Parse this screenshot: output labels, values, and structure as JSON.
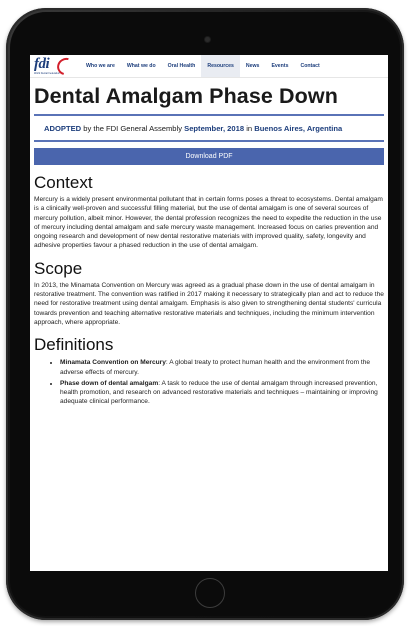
{
  "nav": {
    "logo_text": "fdi",
    "logo_subtitle": "World Dental Federation",
    "items": [
      {
        "label": "Who we are"
      },
      {
        "label": "What we do"
      },
      {
        "label": "Oral Health"
      },
      {
        "label": "Resources"
      },
      {
        "label": "News"
      },
      {
        "label": "Events"
      },
      {
        "label": "Contact"
      }
    ],
    "active_item": "Resources"
  },
  "page": {
    "title": "Dental Amalgam Phase Down",
    "adopted": {
      "strong1": "ADOPTED",
      "text1": " by the FDI General Assembly ",
      "strong2": "September, 2018",
      "text2": " in ",
      "strong3": "Buenos Aires, Argentina"
    },
    "download_label": "Download PDF",
    "sections": [
      {
        "heading": "Context",
        "body": "Mercury is a widely present environmental pollutant that in certain forms poses a threat to ecosystems. Dental amalgam is a clinically well-proven and successful filling material, but the use of dental amalgam is one of several sources of mercury pollution, albeit minor. However, the dental profession recognizes the need to expedite the reduction in the use of mercury including dental amalgam and safe mercury waste management. Increased focus on caries prevention and ongoing research and development of new dental restorative materials with improved quality, safety, longevity and adhesive properties favour a phased reduction in the use of dental amalgam."
      },
      {
        "heading": "Scope",
        "body": "In 2013, the Minamata Convention on Mercury was agreed as a gradual phase down in the use of dental amalgam in restorative treatment. The convention was ratified in 2017 making it necessary to strategically plan and act to reduce the need for restorative treatment using dental amalgam. Emphasis is also given to strengthening dental students' curricula towards prevention and teaching alternative restorative materials and techniques, including the minimum intervention approach, where appropriate."
      },
      {
        "heading": "Definitions",
        "items": [
          {
            "term": "Minamata Convention on Mercury",
            "text": ": A global treaty to protect human health and the environment from the adverse effects of mercury."
          },
          {
            "term": "Phase down of dental amalgam",
            "text": ": A task to reduce the use of dental amalgam through increased prevention, health promotion, and research on advanced restorative materials and techniques – maintaining or improving adequate clinical performance."
          }
        ]
      }
    ]
  },
  "colors": {
    "brand_blue": "#1d3e7c",
    "accent_red": "#d21f2b",
    "button_blue": "#4a65ad",
    "rule_blue": "#5a73b7"
  }
}
